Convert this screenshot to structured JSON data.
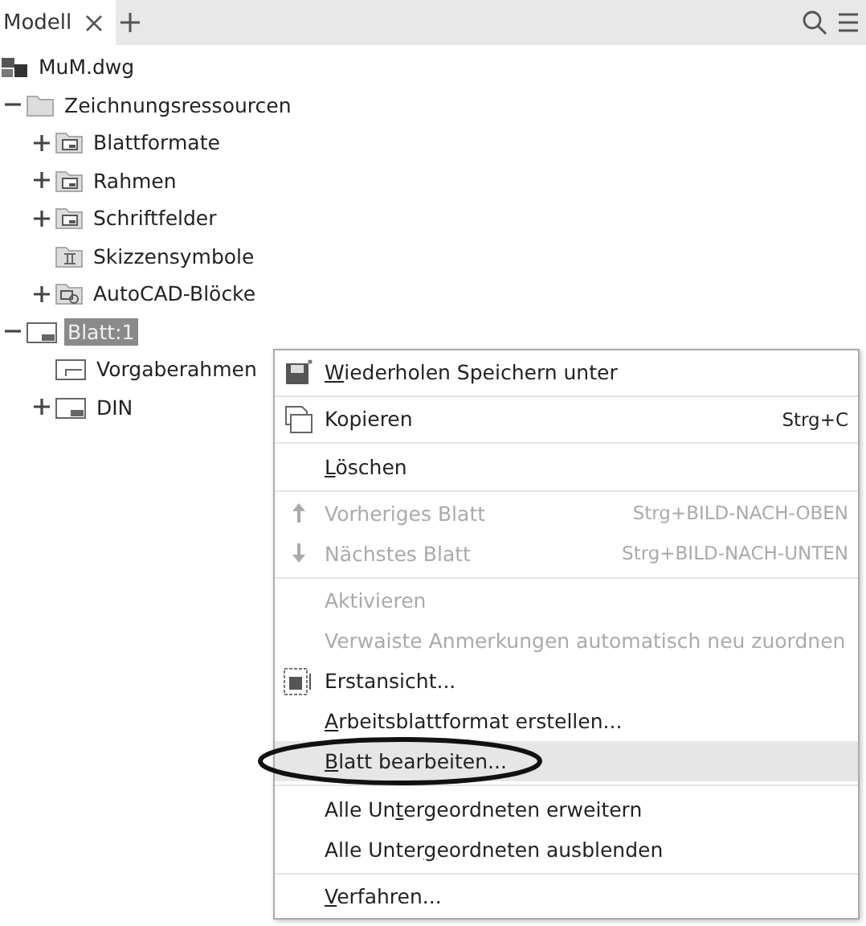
{
  "tabs": [
    {
      "label": "Modell",
      "selected": true,
      "closable": true
    }
  ],
  "tree": [
    {
      "label": "MuM.dwg",
      "kind": "file",
      "selected": false,
      "children": [
        {
          "label": "Zeichnungsressourcen",
          "kind": "folder",
          "selected": false,
          "expanded": true,
          "children": [
            {
              "label": "Blattformate",
              "kind": "sheet-folder",
              "selected": false,
              "expanded": false
            },
            {
              "label": "Rahmen",
              "kind": "sheet-folder",
              "selected": false,
              "expanded": false
            },
            {
              "label": "Schriftfelder",
              "kind": "sheet-folder",
              "selected": false,
              "expanded": false
            },
            {
              "label": "Skizzensymbole",
              "kind": "symbol-folder",
              "selected": false
            },
            {
              "label": "AutoCAD-Blöcke",
              "kind": "block-folder",
              "selected": false,
              "expanded": false
            }
          ]
        },
        {
          "label": "Blatt:1",
          "kind": "sheet",
          "selected": true,
          "expanded": true,
          "children": [
            {
              "label": "Vorgaberahmen",
              "kind": "frame",
              "selected": false
            },
            {
              "label": "DIN",
              "kind": "sheet",
              "selected": false,
              "expanded": false
            }
          ]
        }
      ]
    }
  ],
  "context_menu": [
    {
      "kind": "save",
      "mnemonic": "W",
      "label_end": "iederholen Speichern unter",
      "disabled": false,
      "selected": false
    },
    {
      "kind": "separator"
    },
    {
      "kind": "copy",
      "label_end": "Kopieren",
      "shortcut": "Strg+C",
      "disabled": false,
      "selected": false
    },
    {
      "kind": "separator"
    },
    {
      "kind": "plain",
      "mnemonic": "L",
      "label_end": "öschen",
      "disabled": false,
      "selected": false
    },
    {
      "kind": "separator"
    },
    {
      "kind": "up",
      "label_end": "Vorheriges Blatt",
      "shortcut": "Strg+BILD-NACH-OBEN",
      "disabled": true,
      "selected": false
    },
    {
      "kind": "down",
      "label_end": "Nächstes Blatt",
      "shortcut": "Strg+BILD-NACH-UNTEN",
      "disabled": true,
      "selected": false
    },
    {
      "kind": "separator"
    },
    {
      "kind": "plain",
      "label_end": "Aktivieren",
      "disabled": true,
      "selected": false
    },
    {
      "kind": "plain",
      "label_end": "Verwaiste Anmerkungen automatisch neu zuordnen",
      "disabled": true,
      "selected": false
    },
    {
      "kind": "view",
      "label_end": "Erstansicht...",
      "disabled": false,
      "selected": false
    },
    {
      "kind": "plain",
      "mnemonic": "A",
      "label_end": "rbeitsblattformat erstellen...",
      "disabled": false,
      "selected": false
    },
    {
      "kind": "plain",
      "mnemonic": "B",
      "label_end": "latt bearbeiten...",
      "disabled": false,
      "selected": true,
      "circled": true
    },
    {
      "kind": "separator"
    },
    {
      "kind": "plain",
      "label_start": "Alle Un",
      "mnemonic": "t",
      "label_end": "ergeordneten erweitern",
      "disabled": false,
      "selected": false
    },
    {
      "kind": "plain",
      "label_start": "Alle Unter",
      "mnemonic": "g",
      "label_end": "eordneten ausblenden",
      "disabled": false,
      "selected": false
    },
    {
      "kind": "separator"
    },
    {
      "kind": "plain",
      "mnemonic": "V",
      "label_end": "erfahren...",
      "disabled": false,
      "selected": false
    }
  ]
}
